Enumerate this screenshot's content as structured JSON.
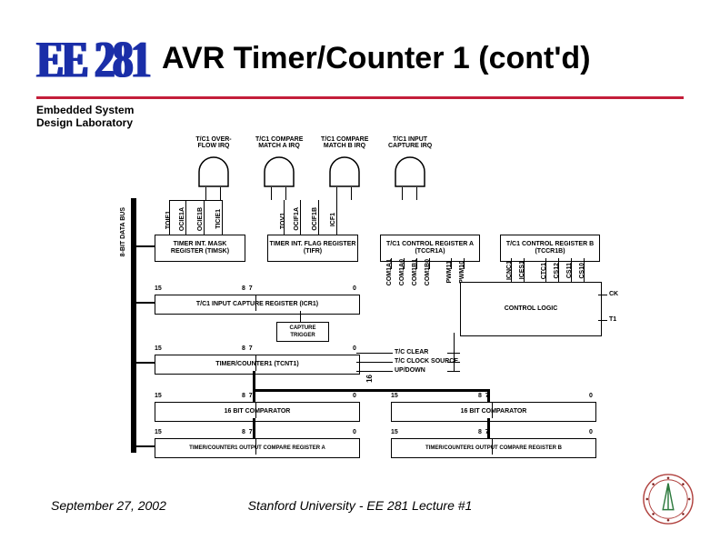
{
  "header": {
    "logo": "EE 281",
    "title": "AVR Timer/Counter 1 (cont'd)",
    "subhead_line1": "Embedded System",
    "subhead_line2": "Design Laboratory"
  },
  "footer": {
    "date": "September 27, 2002",
    "center": "Stanford University - EE 281 Lecture #1"
  },
  "diagram": {
    "irq": {
      "a": "T/C1 OVER-\nFLOW IRQ",
      "b": "T/C1 COMPARE\nMATCH A IRQ",
      "c": "T/C1 COMPARE\nMATCH B IRQ",
      "d": "T/C1 INPUT\nCAPTURE IRQ"
    },
    "bus_label": "8-BIT DATA BUS",
    "regs": {
      "timsk": "TIMER INT. MASK\nREGISTER (TIMSK)",
      "tifr": "TIMER INT. FLAG\nREGISTER (TIFR)",
      "tccr1a": "T/C1 CONTROL\nREGISTER A (TCCR1A)",
      "tccr1b": "T/C1 CONTROL\nREGISTER B (TCCR1B)",
      "icr1": "T/C1 INPUT CAPTURE REGISTER (ICR1)",
      "tcnt1": "TIMER/COUNTER1 (TCNT1)",
      "ctrl": "CONTROL\nLOGIC",
      "capt": "CAPTURE\nTRIGGER",
      "cmp_a": "16 BIT COMPARATOR",
      "cmp_b": "16 BIT COMPARATOR",
      "ocra": "TIMER/COUNTER1 OUTPUT COMPARE REGISTER A",
      "ocrb": "TIMER/COUNTER1 OUTPUT COMPARE REGISTER B"
    },
    "bits_timsk": [
      "TOIE1",
      "OCIE1A",
      "OCIE1B",
      "TICIE1"
    ],
    "bits_tifr": [
      "TOV1",
      "OCIF1A",
      "OCIF1B",
      "ICF1"
    ],
    "bits_tccr1a": [
      "COM1A1",
      "COM1A0",
      "COM1B1",
      "COM1B0",
      "PWM11",
      "PWM10"
    ],
    "bits_tccr1b": [
      "ICNC1",
      "ICES1",
      "CTC1",
      "CS12",
      "CS11",
      "CS10"
    ],
    "ctrl_in": {
      "ck": "CK",
      "t1": "T1"
    },
    "ctrl_out": [
      "T/C CLEAR",
      "T/C CLOCK SOURCE",
      "UP/DOWN"
    ],
    "bit_15": "15",
    "bit_87": "8  7",
    "bit_0": "0",
    "bus_16": "16"
  }
}
